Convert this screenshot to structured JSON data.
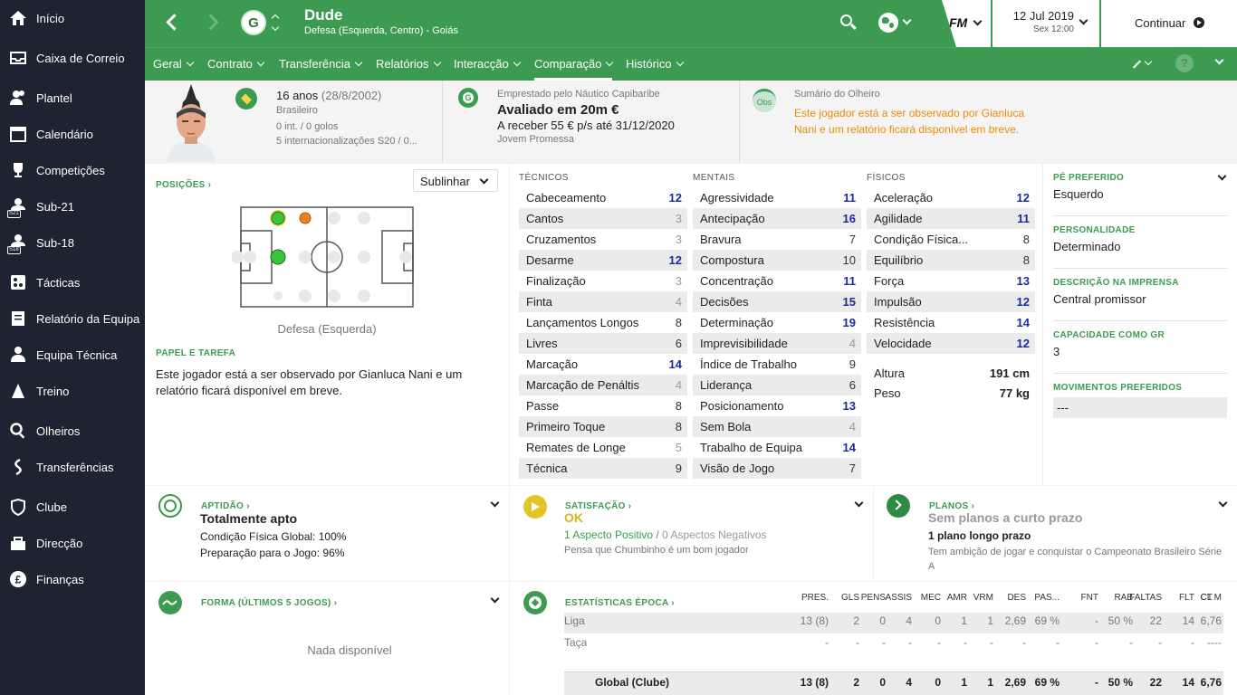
{
  "sidebar": {
    "items": [
      {
        "label": "Início",
        "icon": "home-icon"
      },
      {
        "label": "Caixa de Correio",
        "icon": "inbox-icon"
      },
      {
        "label": "Plantel",
        "icon": "squad-icon"
      },
      {
        "label": "Calendário",
        "icon": "calendar-icon"
      },
      {
        "label": "Competições",
        "icon": "trophy-icon"
      },
      {
        "label": "Sub-21",
        "icon": "u21-icon",
        "badge": "S21"
      },
      {
        "label": "Sub-18",
        "icon": "u18-icon",
        "badge": "S18"
      },
      {
        "label": "Tácticas",
        "icon": "tactics-icon"
      },
      {
        "label": "Relatório da Equipa",
        "icon": "report-icon"
      },
      {
        "label": "Equipa Técnica",
        "icon": "staff-icon"
      },
      {
        "label": "Treino",
        "icon": "training-icon"
      },
      {
        "label": "Olheiros",
        "icon": "scouting-icon"
      },
      {
        "label": "Transferências",
        "icon": "transfers-icon"
      },
      {
        "label": "Clube",
        "icon": "club-icon"
      },
      {
        "label": "Direcção",
        "icon": "board-icon"
      },
      {
        "label": "Finanças",
        "icon": "finances-icon"
      }
    ]
  },
  "header": {
    "player_name": "Dude",
    "player_subtitle": "Defesa (Esquerda, Centro) - Goiás",
    "club_badge_letter": "G",
    "date": "12 Jul 2019",
    "day_time": "Sex 12:00",
    "fm_logo": "FM",
    "continue_label": "Continuar"
  },
  "tabs": [
    {
      "label": "Geral"
    },
    {
      "label": "Contrato"
    },
    {
      "label": "Transferência"
    },
    {
      "label": "Relatórios"
    },
    {
      "label": "Interacção"
    },
    {
      "label": "Comparação",
      "active": true
    },
    {
      "label": "Histórico"
    }
  ],
  "info": {
    "age": "16 anos",
    "dob": "(28/8/2002)",
    "nationality": "Brasileiro",
    "caps": "0 int. / 0 golos",
    "youth_caps": "5 internacionalizações S20 / 0...",
    "loan_from": "Emprestado pelo Náutico Capibaribe",
    "value": "Avaliado em 20m €",
    "wage": "A receber 55 € p/s até 31/12/2020",
    "status": "Jovem Promessa",
    "scout_badge": "Obs",
    "scout_title": "Sumário do Olheiro",
    "scout_text": "Este jogador está a ser observado por Gianluca Nani e um relatório ficará disponível em breve."
  },
  "positions": {
    "title": "POSIÇÕES",
    "highlight_select": "Sublinhar",
    "position_label": "Defesa (Esquerda)",
    "role_title": "PAPEL E TAREFA",
    "role_text": "Este jogador está a ser observado por Gianluca Nani e um relatório ficará disponível em breve."
  },
  "attributes": {
    "technical": {
      "title": "TÉCNICOS",
      "items": [
        {
          "name": "Cabeceamento",
          "value": "12"
        },
        {
          "name": "Cantos",
          "value": "3"
        },
        {
          "name": "Cruzamentos",
          "value": "3"
        },
        {
          "name": "Desarme",
          "value": "12"
        },
        {
          "name": "Finalização",
          "value": "3"
        },
        {
          "name": "Finta",
          "value": "4"
        },
        {
          "name": "Lançamentos Longos",
          "value": "8"
        },
        {
          "name": "Livres",
          "value": "6"
        },
        {
          "name": "Marcação",
          "value": "14"
        },
        {
          "name": "Marcação de Penáltis",
          "value": "4"
        },
        {
          "name": "Passe",
          "value": "8"
        },
        {
          "name": "Primeiro Toque",
          "value": "8"
        },
        {
          "name": "Remates de Longe",
          "value": "5"
        },
        {
          "name": "Técnica",
          "value": "9"
        }
      ]
    },
    "mental": {
      "title": "MENTAIS",
      "items": [
        {
          "name": "Agressividade",
          "value": "11"
        },
        {
          "name": "Antecipação",
          "value": "16"
        },
        {
          "name": "Bravura",
          "value": "7"
        },
        {
          "name": "Compostura",
          "value": "10"
        },
        {
          "name": "Concentração",
          "value": "11"
        },
        {
          "name": "Decisões",
          "value": "15"
        },
        {
          "name": "Determinação",
          "value": "19"
        },
        {
          "name": "Imprevisibilidade",
          "value": "4"
        },
        {
          "name": "Índice de Trabalho",
          "value": "9"
        },
        {
          "name": "Liderança",
          "value": "6"
        },
        {
          "name": "Posicionamento",
          "value": "13"
        },
        {
          "name": "Sem Bola",
          "value": "4"
        },
        {
          "name": "Trabalho de Equipa",
          "value": "14"
        },
        {
          "name": "Visão de Jogo",
          "value": "7"
        }
      ]
    },
    "physical": {
      "title": "FÍSICOS",
      "items": [
        {
          "name": "Aceleração",
          "value": "12"
        },
        {
          "name": "Agilidade",
          "value": "11"
        },
        {
          "name": "Condição Física...",
          "value": "8"
        },
        {
          "name": "Equilíbrio",
          "value": "8"
        },
        {
          "name": "Força",
          "value": "13"
        },
        {
          "name": "Impulsão",
          "value": "12"
        },
        {
          "name": "Resistência",
          "value": "14"
        },
        {
          "name": "Velocidade",
          "value": "12"
        }
      ]
    },
    "height_label": "Altura",
    "height": "191 cm",
    "weight_label": "Peso",
    "weight": "77 kg"
  },
  "details": [
    {
      "title": "PÉ PREFERIDO",
      "value": "Esquerdo"
    },
    {
      "title": "PERSONALIDADE",
      "value": "Determinado"
    },
    {
      "title": "DESCRIÇÃO NA IMPRENSA",
      "value": "Central promissor"
    },
    {
      "title": "CAPACIDADE COMO GR",
      "value": "3"
    },
    {
      "title": "MOVIMENTOS PREFERIDOS",
      "value": "---"
    }
  ],
  "fitness": {
    "title": "APTIDÃO",
    "status": "Totalmente apto",
    "condition": "Condição Física Global: 100%",
    "sharpness": "Preparação para o Jogo: 96%"
  },
  "satisfaction": {
    "title": "SATISFAÇÃO",
    "status": "OK",
    "positive": "1 Aspecto Positivo",
    "separator": "/",
    "negative": "0 Aspectos Negativos",
    "note": "Pensa que Chumbinho é um bom jogador"
  },
  "plans": {
    "title": "PLANOS",
    "short_term": "Sem planos a curto prazo",
    "long_term": "1 plano longo prazo",
    "ambition": "Tem ambição de jogar e conquistar o Campeonato Brasileiro Série A"
  },
  "form": {
    "title": "FORMA (ÚLTIMOS 5 JOGOS)",
    "empty": "Nada disponível"
  },
  "season_stats": {
    "title": "ESTATÍSTICAS ÉPOCA",
    "columns": [
      "PRES.",
      "GLS",
      "PENS",
      "ASSIS",
      "MEC",
      "AMR",
      "VRM",
      "DES",
      "PAS...",
      "FNT",
      "RAB",
      "FALTAS",
      "FLT",
      "CT",
      "CL M"
    ],
    "rows": [
      {
        "name": "Liga",
        "values": [
          "13 (8)",
          "2",
          "0",
          "4",
          "0",
          "1",
          "1",
          "2,69",
          "69 %",
          "-",
          "50 %",
          "22",
          "14",
          "",
          "6,76"
        ]
      },
      {
        "name": "Taça",
        "values": [
          "-",
          "-",
          "-",
          "-",
          "-",
          "-",
          "-",
          "-",
          "-",
          "-",
          "-",
          "-",
          "-",
          "",
          "----"
        ]
      }
    ],
    "total": {
      "name": "Global (Clube)",
      "values": [
        "13 (8)",
        "2",
        "0",
        "4",
        "0",
        "1",
        "1",
        "2,69",
        "69 %",
        "-",
        "50 %",
        "22",
        "14",
        "",
        "6,76"
      ]
    }
  }
}
